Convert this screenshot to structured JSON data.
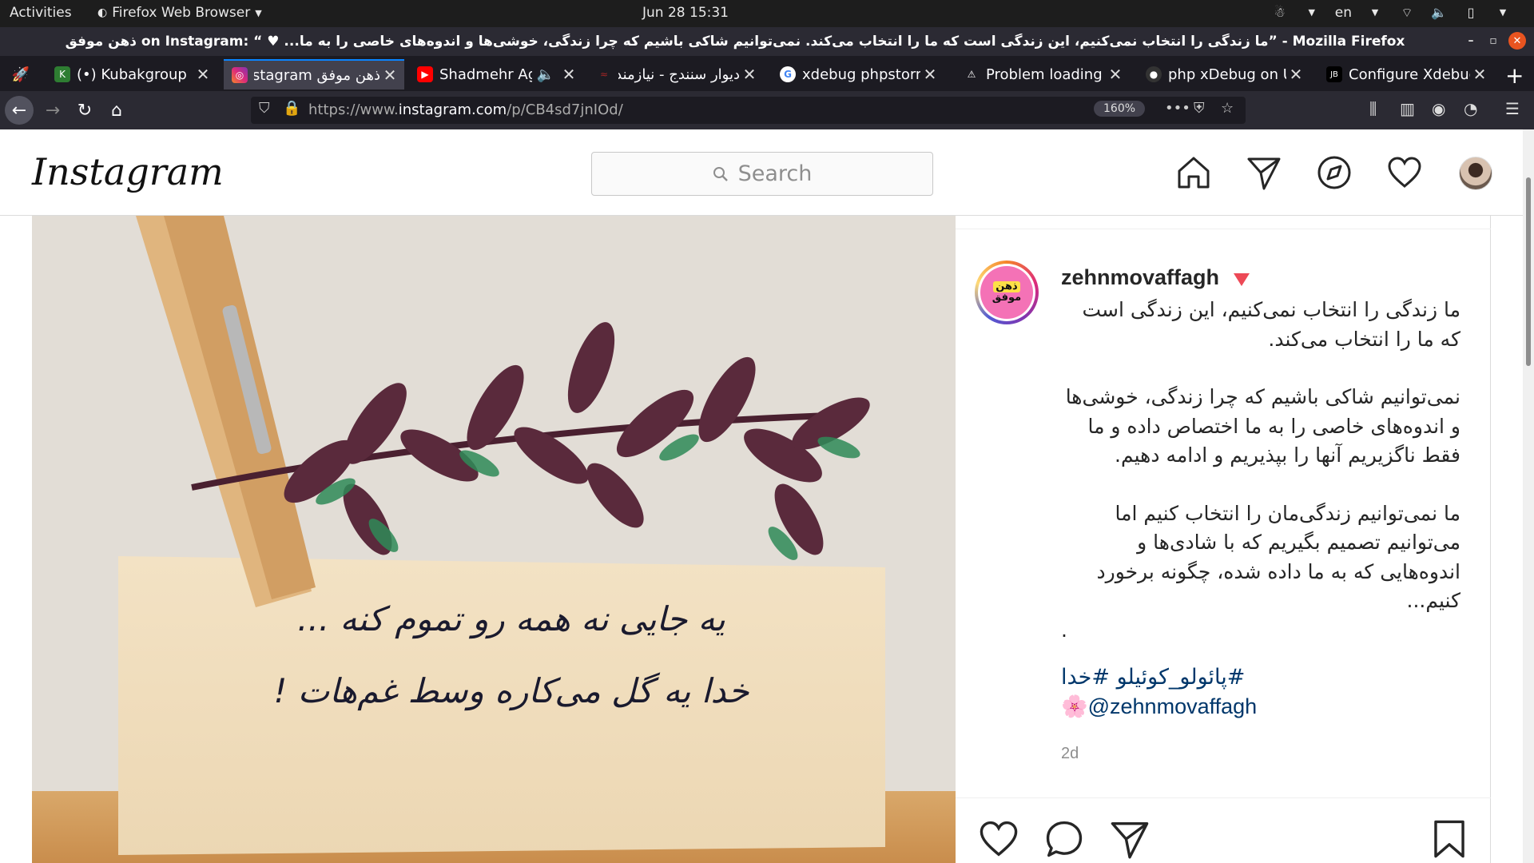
{
  "system_bar": {
    "activities": "Activities",
    "app_menu": "Firefox Web Browser",
    "clock": "Jun 28  15:31",
    "language": "en"
  },
  "window": {
    "title": "ذهن موفق on Instagram: “ ♥ ...ما زندگی را انتخاب نمی‌کنیم، این زندگی است که ما را انتخاب می‌کند. نمی‌توانیم شاکی باشیم که چرا زندگی، خوشی‌ها و اندوه‌های خاصی را به ما” - Mozilla Firefox"
  },
  "tabs": [
    {
      "label": "",
      "icon": "rocket-icon"
    },
    {
      "label": "(•) Kubakgroup",
      "icon": "kubakgroup-favicon"
    },
    {
      "label": "ذهن موفق on Instagram",
      "icon": "instagram-favicon",
      "active": true
    },
    {
      "label": "Shadmehr Aghili",
      "icon": "youtube-favicon"
    },
    {
      "label": "دیوار سنندج - نیازمند",
      "icon": "divar-favicon"
    },
    {
      "label": "xdebug phpstorm",
      "icon": "google-favicon"
    },
    {
      "label": "Problem loading page",
      "icon": "warning-icon"
    },
    {
      "label": "php xDebug on Ubuntu",
      "icon": "github-favicon"
    },
    {
      "label": "Configure Xdebug",
      "icon": "jetbrains-favicon"
    }
  ],
  "navbar": {
    "url_prefix": "https://www.",
    "url_domain": "instagram.com",
    "url_path": "/p/CB4sd7jnIOd/",
    "zoom": "160%"
  },
  "instagram": {
    "logo": "Instagram",
    "search_placeholder": "Search",
    "post": {
      "username": "zehnmovaffagh",
      "avatar_text_top": "ذهن",
      "avatar_text_bottom": "موفق",
      "caption": [
        "ما زندگی را انتخاب نمی‌کنیم، این زندگی است که ما را انتخاب می‌کند.",
        "نمی‌توانیم شاکی باشیم که چرا زندگی، خوشی‌ها و اندوه‌های خاصی را به ما اختصاص داده و ما فقط ناگزیریم آنها را بپذیریم و ادامه دهیم.",
        "ما نمی‌توانیم زندگی‌مان را انتخاب کنیم اما می‌توانیم تصمیم بگیریم که با شادی‌ها و اندوه‌هایی که به ما داده شده، چگونه برخورد کنیم..."
      ],
      "caption_dot": ".",
      "hashtags": "#پائولو_کوئیلو #خدا",
      "mention": "🌸@zehnmovaffagh",
      "time": "2d",
      "handwriting_line1": "یه جایی نه همه رو تموم کنه ...",
      "handwriting_line2": "خدا یه گل می‌کاره وسط غم‌هات !"
    }
  }
}
